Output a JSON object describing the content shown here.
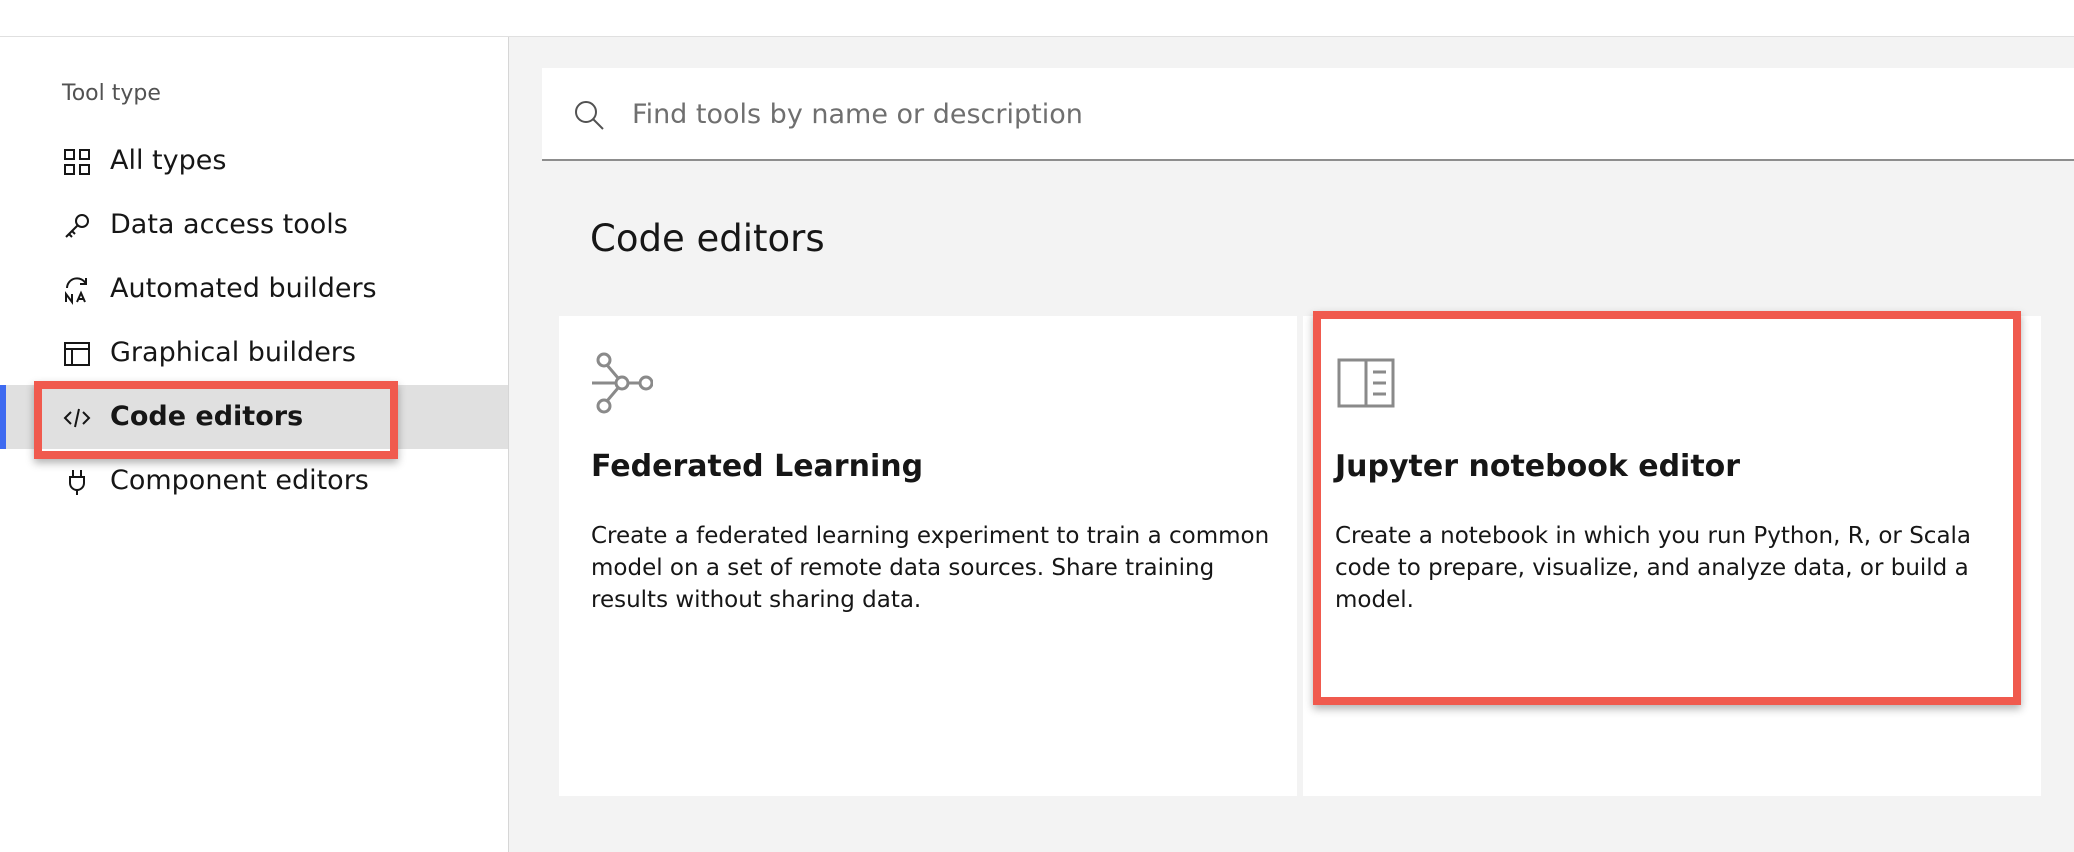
{
  "sidebar": {
    "heading": "Tool type",
    "items": [
      {
        "label": "All types",
        "icon": "grid-icon"
      },
      {
        "label": "Data access tools",
        "icon": "key-icon"
      },
      {
        "label": "Automated builders",
        "icon": "automation-icon"
      },
      {
        "label": "Graphical builders",
        "icon": "window-icon"
      },
      {
        "label": "Code editors",
        "icon": "code-icon",
        "active": true
      },
      {
        "label": "Component editors",
        "icon": "plug-icon"
      }
    ]
  },
  "search": {
    "placeholder": "Find tools by name or description",
    "icon": "search-icon"
  },
  "main": {
    "section_title": "Code editors",
    "cards": [
      {
        "title": "Federated Learning",
        "description": "Create a federated learning experiment to train a common model on a set of remote data sources. Share training results without sharing data.",
        "icon": "network-icon"
      },
      {
        "title": "Jupyter notebook editor",
        "description": "Create a notebook in which you run Python, R, or Scala code to prepare, visualize, and analyze data, or build a model.",
        "icon": "notebook-icon"
      }
    ]
  },
  "colors": {
    "accent": "#3e6af0",
    "highlight": "#f05a4e",
    "main_background": "#f3f3f3",
    "active_item_background": "#e0e0e0"
  }
}
